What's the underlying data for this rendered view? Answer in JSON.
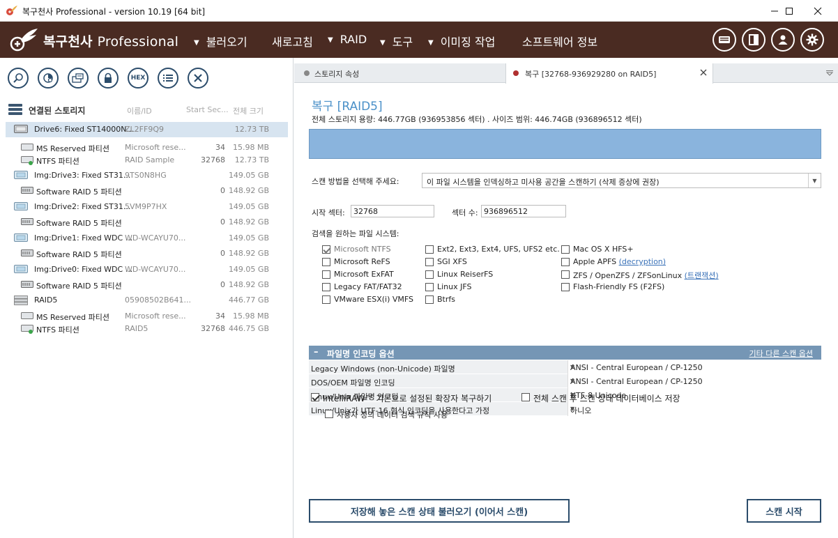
{
  "window": {
    "title": "복구천사 Professional - version 10.19 [64 bit]"
  },
  "header": {
    "brand_name": "복구천사",
    "brand_suffix": "Professional",
    "menu": [
      {
        "label": "불러오기",
        "has_arrow": true
      },
      {
        "label": "새로고침",
        "has_arrow": false
      },
      {
        "label": "RAID",
        "has_arrow": true
      },
      {
        "label": "도구",
        "has_arrow": true
      },
      {
        "label": "이미징 작업",
        "has_arrow": true
      },
      {
        "label": "소프트웨어 정보",
        "has_arrow": false
      }
    ],
    "icons": [
      "keyboard-icon",
      "panel-icon",
      "user-icon",
      "gear-icon"
    ]
  },
  "toolbar": {
    "icons": [
      "search-icon",
      "partition-scan-icon",
      "open-image-icon",
      "lock-icon",
      "hex-icon",
      "list-icon",
      "close-icon"
    ],
    "hex_label": "HEX"
  },
  "storage": {
    "header": {
      "title": "연결된 스토리지",
      "col_name": "이름/ID",
      "col_start": "Start Sec...",
      "col_size": "전체 크기"
    },
    "rows": [
      {
        "name": "Drive6: Fixed ST14000N...",
        "id": "ZL2FF9Q9",
        "start": "",
        "size": "12.73 TB",
        "type": "disk",
        "level": 0,
        "selected": true
      },
      {
        "name": "MS Reserved 파티션",
        "id": "Microsoft rese...",
        "start": "34",
        "size": "15.98 MB",
        "type": "partition",
        "level": 1
      },
      {
        "name": "NTFS 파티션",
        "id": "RAID Sample",
        "start": "32768",
        "size": "12.73 TB",
        "type": "ntfs",
        "level": 1
      },
      {
        "name": "Img:Drive3: Fixed ST31...",
        "id": "9TS0N8HG",
        "start": "",
        "size": "149.05 GB",
        "type": "image",
        "level": 0
      },
      {
        "name": "Software RAID 5 파티션",
        "id": "",
        "start": "0",
        "size": "148.92 GB",
        "type": "raid-part",
        "level": 1
      },
      {
        "name": "Img:Drive2: Fixed ST31...",
        "id": "5VM9P7HX",
        "start": "",
        "size": "149.05 GB",
        "type": "image",
        "level": 0
      },
      {
        "name": "Software RAID 5 파티션",
        "id": "",
        "start": "0",
        "size": "148.92 GB",
        "type": "raid-part",
        "level": 1
      },
      {
        "name": "Img:Drive1: Fixed WDC ...",
        "id": "WD-WCAYU70...",
        "start": "",
        "size": "149.05 GB",
        "type": "image",
        "level": 0
      },
      {
        "name": "Software RAID 5 파티션",
        "id": "",
        "start": "0",
        "size": "148.92 GB",
        "type": "raid-part",
        "level": 1
      },
      {
        "name": "Img:Drive0: Fixed WDC ...",
        "id": "WD-WCAYU70...",
        "start": "",
        "size": "149.05 GB",
        "type": "image",
        "level": 0
      },
      {
        "name": "Software RAID 5 파티션",
        "id": "",
        "start": "0",
        "size": "148.92 GB",
        "type": "raid-part",
        "level": 1
      },
      {
        "name": "RAID5",
        "id": "05908502B641...",
        "start": "",
        "size": "446.77 GB",
        "type": "raid",
        "level": 0
      },
      {
        "name": "MS Reserved 파티션",
        "id": "Microsoft rese...",
        "start": "34",
        "size": "15.98 MB",
        "type": "partition",
        "level": 1
      },
      {
        "name": "NTFS 파티션",
        "id": "RAID5",
        "start": "32768",
        "size": "446.75 GB",
        "type": "ntfs",
        "level": 1
      }
    ]
  },
  "tabs": [
    {
      "label": "스토리지 속성",
      "active": false,
      "dot_color": "#888888"
    },
    {
      "label": "복구 [32768-936929280 on RAID5]",
      "active": true,
      "dot_color": "#b03030"
    }
  ],
  "recovery": {
    "title": "복구 [RAID5]",
    "subtitle": "전체 스토리지 용량: 446.77GB (936953856 섹터) . 사이즈 범위: 446.74GB (936896512 섹터)",
    "scan_method_label": "스캔 방법을 선택해 주세요:",
    "scan_method_value": "이 파일 시스템을 인덱싱하고 미사용 공간을 스캔하기 (삭제 증상에 권장)",
    "start_sector_label": "시작 섹터:",
    "start_sector_value": "32768",
    "sector_count_label": "섹터 수:",
    "sector_count_value": "936896512",
    "fs_label": "검색을 원하는 파일 시스템:",
    "filesystems": [
      {
        "label": "Microsoft NTFS",
        "checked": true,
        "grey": true
      },
      {
        "label": "Microsoft ReFS",
        "checked": false
      },
      {
        "label": "Microsoft ExFAT",
        "checked": false
      },
      {
        "label": "Legacy FAT/FAT32",
        "checked": false
      },
      {
        "label": "VMware ESX(i) VMFS",
        "checked": false
      },
      {
        "label": "Ext2, Ext3, Ext4, UFS, UFS2 etc.",
        "checked": false
      },
      {
        "label": "SGI XFS",
        "checked": false
      },
      {
        "label": "Linux ReiserFS",
        "checked": false
      },
      {
        "label": "Linux JFS",
        "checked": false
      },
      {
        "label": "Btrfs",
        "checked": false
      },
      {
        "label": "Mac OS X HFS+",
        "checked": false
      },
      {
        "label": "Apple APFS",
        "link": "(decryption)",
        "checked": false
      },
      {
        "label": "ZFS / OpenZFS / ZFSonLinux",
        "link": "(트랜잭션)",
        "checked": false
      },
      {
        "label": "Flash-Friendly FS (F2FS)",
        "checked": false
      }
    ],
    "encoding": {
      "header": "파일명 인코딩 옵션",
      "other_options_link": "기타 다른 스캔 옵션",
      "rows": [
        {
          "key": "Legacy Windows (non-Unicode) 파일명",
          "value": "ANSI - Central European / CP-1250"
        },
        {
          "key": "DOS/OEM 파일명 인코딩",
          "value": "ANSI - Central European / CP-1250"
        },
        {
          "key": "Linux/Unix 파일명 인코딩",
          "value": "UTF-8 Unicode"
        },
        {
          "key": "Linux/Unix가 UTF-16 형식 인코딩을 사용한다고 가정",
          "value": "아니오"
        }
      ]
    },
    "options": {
      "intelliraw": {
        "label": "IntelliRAW™ 기본으로 설정된 확장자 복구하기",
        "checked": true
      },
      "save_db": {
        "label": "전체 스캔 후 스캔 상태 데이터베이스 저장",
        "checked": false
      },
      "custom_rules": {
        "label": "사용자 정의 데이터 검색 규칙 사용",
        "checked": false
      }
    },
    "load_button": "저장해 놓은 스캔 상태 불러오기 (이어서 스캔)",
    "start_button": "스캔 시작"
  }
}
